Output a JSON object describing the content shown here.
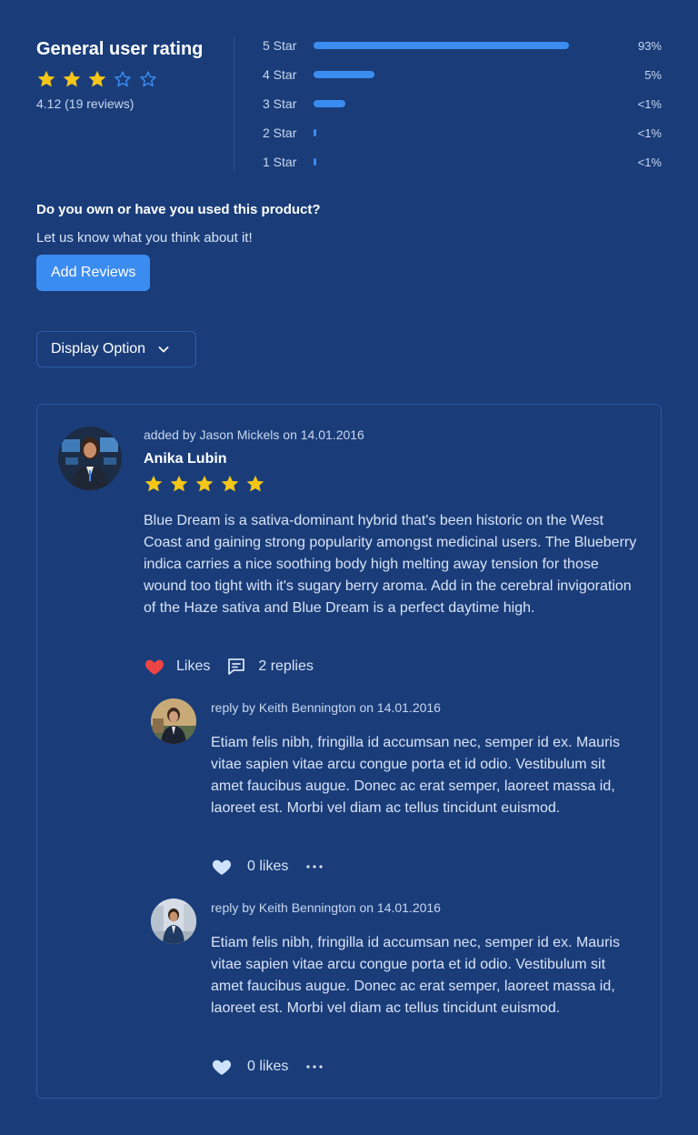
{
  "summary": {
    "title": "General user rating",
    "rating_value": 4.12,
    "stars_filled": 3,
    "stars_total": 5,
    "meta": "4.12 (19 reviews)"
  },
  "breakdown": [
    {
      "label": "5 Star",
      "percent_text": "93%",
      "fill": 0.97
    },
    {
      "label": "4 Star",
      "percent_text": "5%",
      "fill": 0.23
    },
    {
      "label": "3 Star",
      "percent_text": "<1%",
      "fill": 0.12
    },
    {
      "label": "2 Star",
      "percent_text": "<1%",
      "fill": 0.01
    },
    {
      "label": "1 Star",
      "percent_text": "<1%",
      "fill": 0.01
    }
  ],
  "cta": {
    "question": "Do you own or have you used this product?",
    "subtitle": "Let us know what you think about it!",
    "button_label": "Add Reviews"
  },
  "display_option": {
    "label": "Display Option"
  },
  "review": {
    "meta": "added by Jason Mickels on 14.01.2016",
    "name": "Anika Lubin",
    "stars": 5,
    "body": "Blue Dream is a sativa-dominant hybrid that's been historic on the West Coast and gaining strong popularity amongst medicinal users. The Blueberry indica carries a nice soothing body high melting away tension for those wound too tight with it's sugary berry aroma. Add in the cerebral invigoration of the Haze sativa and Blue Dream is a perfect daytime high.",
    "likes_label": "Likes",
    "replies_label": "2 replies",
    "replies": [
      {
        "meta": "reply by Keith Bennington on 14.01.2016",
        "body": "Etiam felis nibh, fringilla id accumsan nec, semper id ex. Mauris vitae sapien vitae arcu congue porta et id odio. Vestibulum sit amet faucibus augue. Donec ac erat semper, laoreet massa id, laoreet est. Morbi vel diam ac tellus tincidunt euismod.",
        "likes_label": "0 likes"
      },
      {
        "meta": "reply by Keith Bennington on 14.01.2016",
        "body": "Etiam felis nibh, fringilla id accumsan nec, semper id ex. Mauris vitae sapien vitae arcu congue porta et id odio. Vestibulum sit amet faucibus augue. Donec ac erat semper, laoreet massa id, laoreet est. Morbi vel diam ac tellus tincidunt euismod.",
        "likes_label": "0 likes"
      }
    ]
  },
  "colors": {
    "background": "#1a3d7a",
    "accent": "#3b8cf0",
    "star": "#f5c518",
    "heart_active": "#ef4444",
    "heart_inactive": "#cfe3ff"
  }
}
